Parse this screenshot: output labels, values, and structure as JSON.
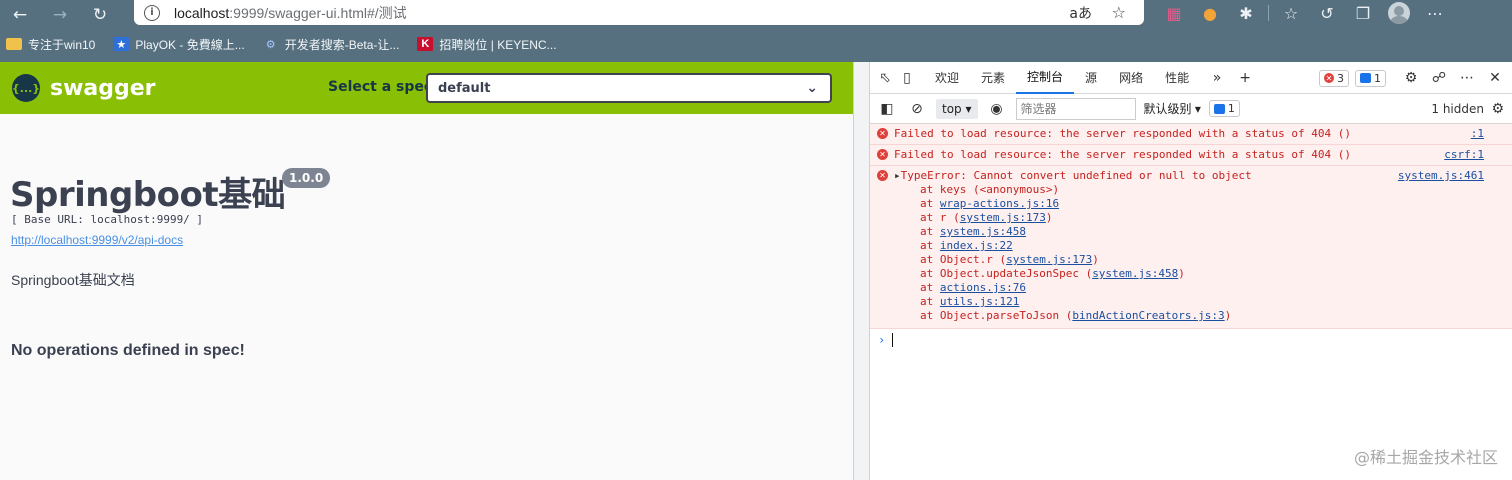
{
  "browser": {
    "address": {
      "host": "localhost",
      "rest": ":9999/swagger-ui.html#/测试",
      "read_aloud": "aあ"
    },
    "bookmarks": [
      {
        "label": "专注于win10",
        "icon": "folder-icon"
      },
      {
        "label": "PlayOK - 免費線上...",
        "icon": "star-icon"
      },
      {
        "label": "开发者搜索-Beta-让...",
        "icon": "gear-icon"
      },
      {
        "label": "招聘岗位 | KEYENC...",
        "icon": "k-logo-icon"
      }
    ]
  },
  "swagger": {
    "brand": "swagger",
    "logo_text": "{...}",
    "select_label": "Select a spec",
    "select_value": "default",
    "title": "Springboot基础",
    "version": "1.0.0",
    "base_url": "[ Base URL: localhost:9999/ ]",
    "api_docs_link": "http://localhost:9999/v2/api-docs",
    "description": "Springboot基础文档",
    "no_operations": "No operations defined in spec!"
  },
  "devtools": {
    "tabs": [
      "欢迎",
      "元素",
      "控制台",
      "源",
      "网络",
      "性能"
    ],
    "active_tab": "控制台",
    "error_count": "3",
    "message_count": "1",
    "context": "top",
    "filter_placeholder": "筛选器",
    "levels": "默认级别",
    "issues_count": "1",
    "hidden": "1 hidden",
    "console": {
      "msg1": "Failed to load resource: the server responded with a status of 404 ()",
      "src1": ":1",
      "msg2": "Failed to load resource: the server responded with a status of 404 ()",
      "src2": "csrf:1",
      "msg3": "TypeError: Cannot convert undefined or null to object",
      "src3": "system.js:461",
      "stack": [
        {
          "pre": "at keys (<anonymous>)",
          "link": "",
          "post": ""
        },
        {
          "pre": "at ",
          "link": "wrap-actions.js:16",
          "post": ""
        },
        {
          "pre": "at r (",
          "link": "system.js:173",
          "post": ")"
        },
        {
          "pre": "at ",
          "link": "system.js:458",
          "post": ""
        },
        {
          "pre": "at ",
          "link": "index.js:22",
          "post": ""
        },
        {
          "pre": "at Object.r (",
          "link": "system.js:173",
          "post": ")"
        },
        {
          "pre": "at Object.updateJsonSpec (",
          "link": "system.js:458",
          "post": ")"
        },
        {
          "pre": "at ",
          "link": "actions.js:76",
          "post": ""
        },
        {
          "pre": "at ",
          "link": "utils.js:121",
          "post": ""
        },
        {
          "pre": "at Object.parseToJson (",
          "link": "bindActionCreators.js:3",
          "post": ")"
        }
      ]
    }
  },
  "watermark": "@稀土掘金技术社区"
}
